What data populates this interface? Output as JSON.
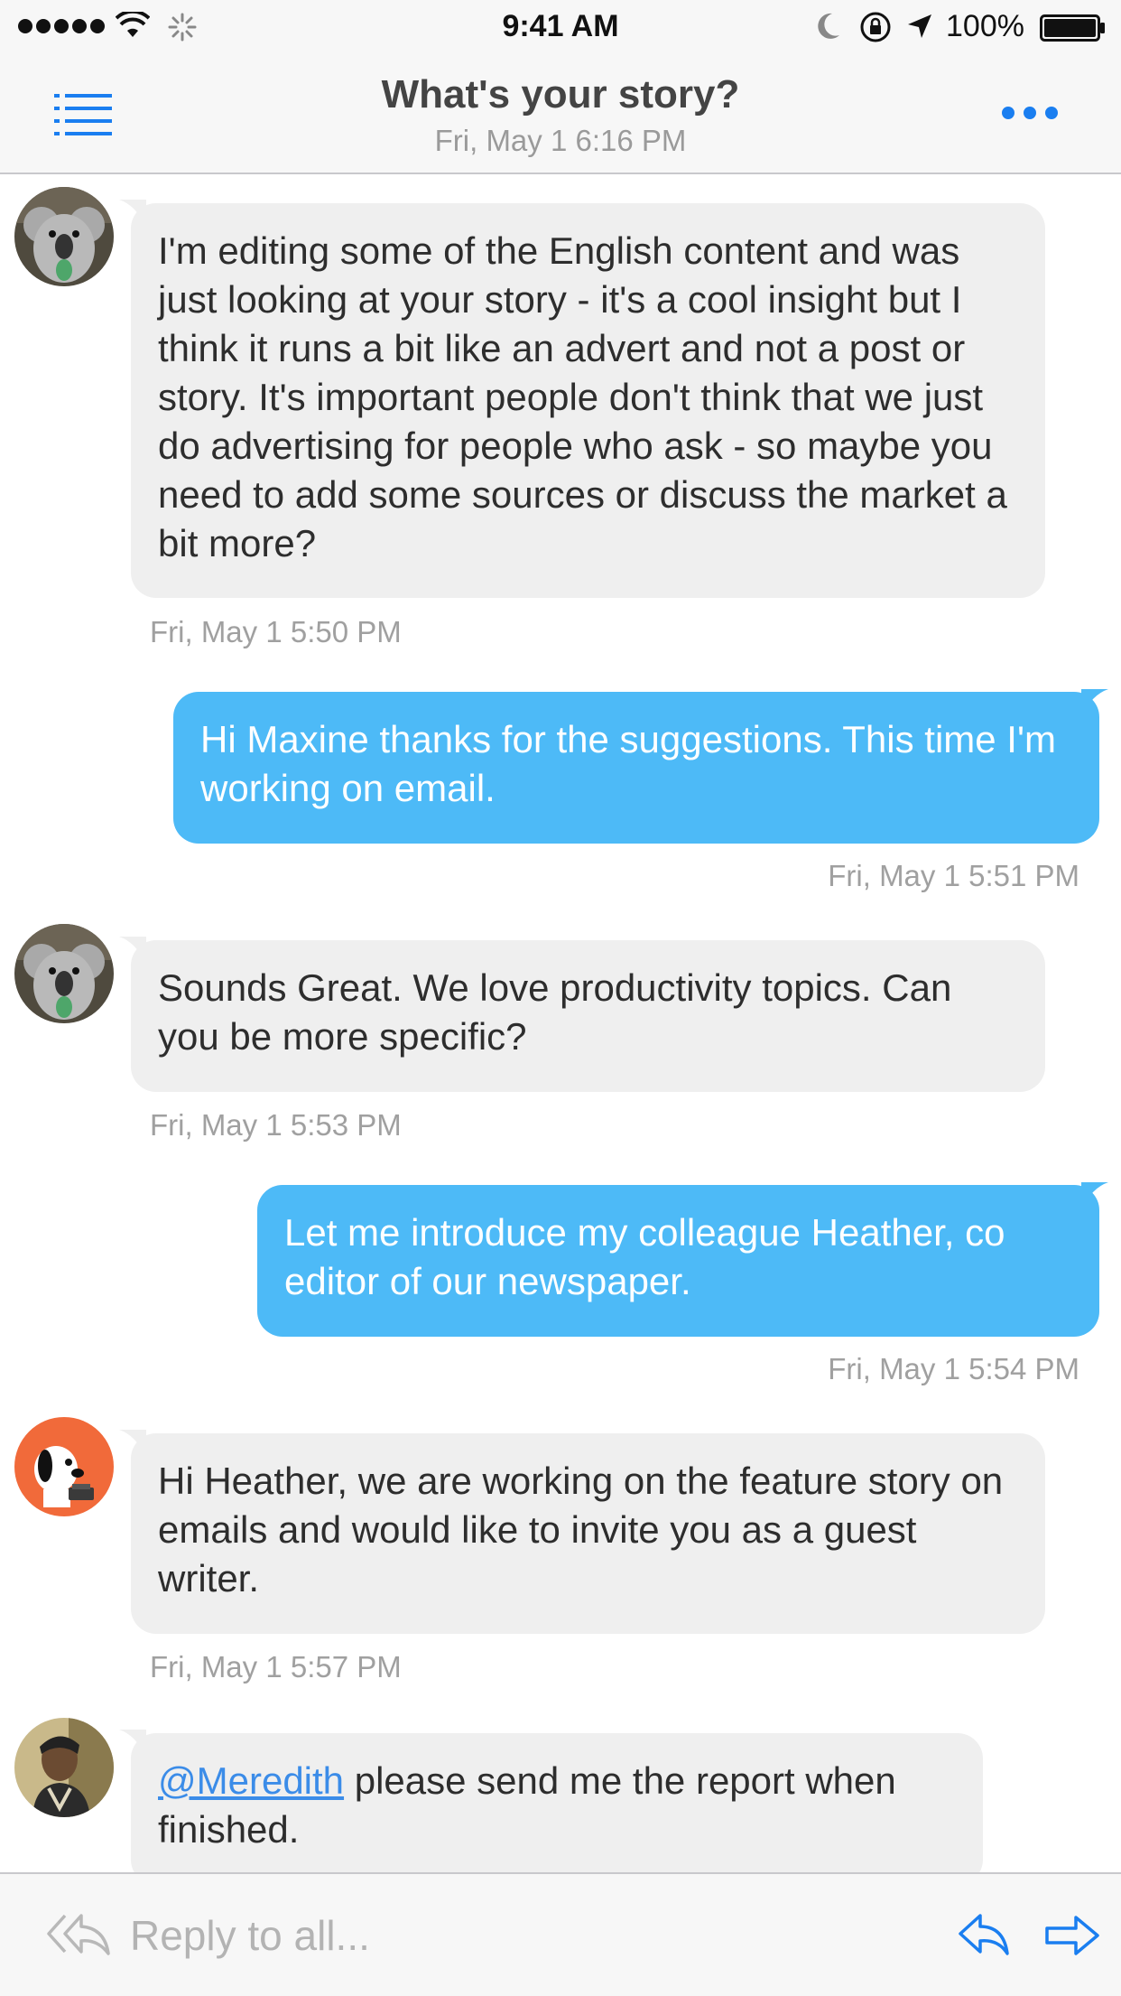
{
  "status_bar": {
    "time": "9:41 AM",
    "battery_percent": "100%"
  },
  "header": {
    "title": "What's your story?",
    "subtitle": "Fri, May 1 6:16 PM"
  },
  "messages": [
    {
      "direction": "incoming",
      "avatar": "koala-avatar",
      "text": "I'm editing some of the English content and was just looking at your story - it's a cool insight but I think it runs a bit like an advert and not a post or story. It's important people don't think that we just do advertising for people who ask - so maybe you need to add some sources or discuss the market a bit more?",
      "time": "Fri, May 1 5:50 PM"
    },
    {
      "direction": "outgoing",
      "text": "Hi Maxine thanks for the suggestions. This time I'm working on email.",
      "time": "Fri, May 1 5:51 PM"
    },
    {
      "direction": "incoming",
      "avatar": "koala-avatar",
      "text": "Sounds Great. We love productivity topics. Can you be more specific?",
      "time": "Fri, May 1 5:53 PM"
    },
    {
      "direction": "outgoing",
      "text": "Let me introduce my colleague Heather, co editor of our newspaper.",
      "time": "Fri, May 1 5:54 PM"
    },
    {
      "direction": "incoming",
      "avatar": "snoopy-avatar",
      "text": "Hi Heather, we are working on the feature story on emails and would like to invite you as a guest writer.",
      "time": "Fri, May 1 5:57 PM"
    },
    {
      "direction": "incoming",
      "avatar": "man-avatar",
      "mention": "@Meredith",
      "text": " please send me the report when finished."
    }
  ],
  "reply_bar": {
    "placeholder": "Reply to all..."
  },
  "colors": {
    "accent": "#1a7ef0",
    "outgoing_bubble": "#4dbaf7",
    "incoming_bubble": "#efefef"
  }
}
